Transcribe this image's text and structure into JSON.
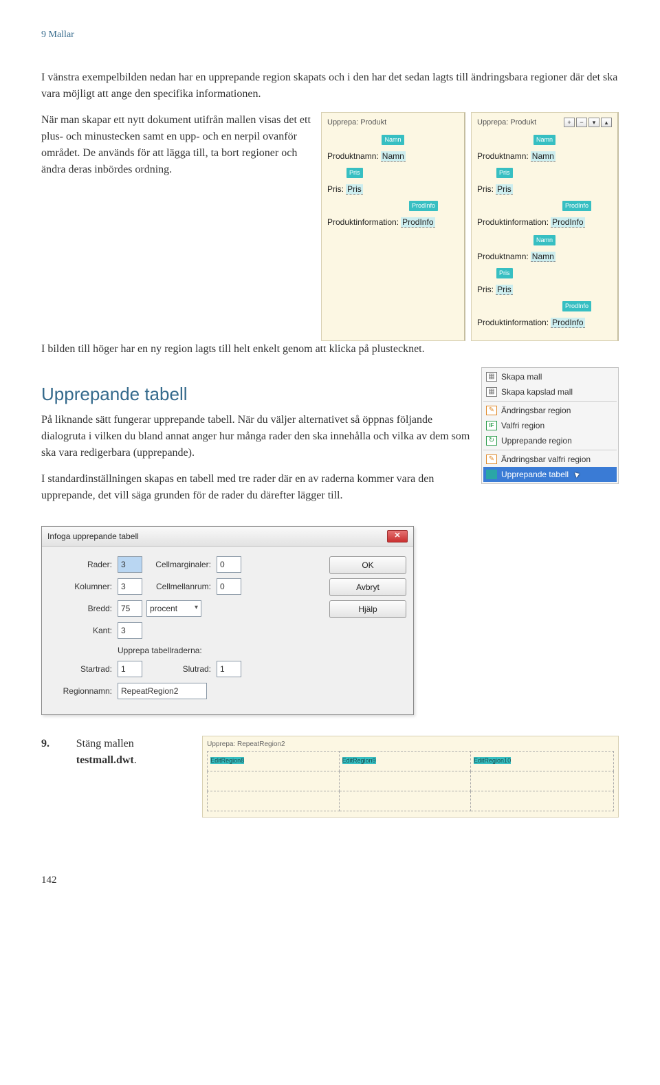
{
  "header": "9 Mallar",
  "intro": "I vänstra exempelbilden nedan har en upprepande region skapats och i den har det sedan lagts till ändringsbara regioner där det ska vara möjligt att ange den specifika informationen.",
  "para2": "När man skapar ett nytt dokument utifrån mallen visas det ett plus- och minustecken samt en upp- och en nerpil ovanför området. De används för att lägga till, ta bort regioner och ändra deras inbördes ordning.",
  "para3": "I bilden till höger har en ny region lagts till helt enkelt genom att klicka på plustecknet.",
  "upprepandeTitle": "Upprepande tabell",
  "para4": "På liknande sätt fungerar upprepande tabell. När du väljer alternativet så öppnas följande dialogruta i vilken du bland annat anger hur många rader den ska innehålla och vilka av dem som ska vara redigerbara (upprepande).",
  "para5": "I standardinställningen skapas en tabell med tre rader där en av raderna kommer vara den upprepande, det vill säga grunden för de rader du därefter lägger till.",
  "region": {
    "headerLabel": "Upprepa: Produkt",
    "nameTag": "Namn",
    "nameLabel": "Produktnamn:",
    "nameVal": "Namn",
    "priceTag": "Pris",
    "priceLabel": "Pris:",
    "priceVal": "Pris",
    "infoTag": "ProdInfo",
    "infoLabel": "Produktinformation:",
    "infoVal": "ProdInfo",
    "btnPlus": "+",
    "btnMinus": "−",
    "btnDown": "▾",
    "btnUp": "▴"
  },
  "menu": {
    "skapaMall": "Skapa mall",
    "skapaKapslad": "Skapa kapslad mall",
    "andringsbar": "Ändringsbar region",
    "valfri": "Valfri region",
    "upprepande": "Upprepande region",
    "andringsbarValfri": "Ändringsbar valfri region",
    "upprepandeTabell": "Upprepande tabell"
  },
  "dialog": {
    "title": "Infoga upprepande tabell",
    "raderLbl": "Rader:",
    "raderVal": "3",
    "cellmargLbl": "Cellmarginaler:",
    "cellmargVal": "0",
    "kolLbl": "Kolumner:",
    "kolVal": "3",
    "cellmelLbl": "Cellmellanrum:",
    "cellmelVal": "0",
    "breddLbl": "Bredd:",
    "breddVal": "75",
    "breddUnit": "procent",
    "kantLbl": "Kant:",
    "kantVal": "3",
    "subhead": "Upprepa tabellraderna:",
    "startLbl": "Startrad:",
    "startVal": "1",
    "slutLbl": "Slutrad:",
    "slutVal": "1",
    "regionLbl": "Regionnamn:",
    "regionVal": "RepeatRegion2",
    "ok": "OK",
    "avbryt": "Avbryt",
    "hjalp": "Hjälp"
  },
  "step": {
    "num": "9.",
    "textA": "Stäng mallen ",
    "textB": "testmall.dwt",
    "dot": "."
  },
  "repeatTable": {
    "title": "Upprepa: RepeatRegion2",
    "c1": "EditRegion8",
    "c2": "EditRegion9",
    "c3": "EditRegion10"
  },
  "pageNum": "142"
}
